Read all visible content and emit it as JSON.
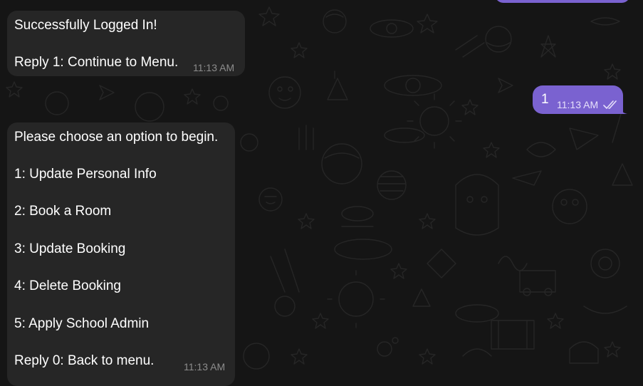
{
  "messages": [
    {
      "direction": "incoming",
      "lines": [
        "Successfully Logged In!",
        "",
        "Reply 1: Continue to Menu."
      ],
      "time": "11:13 AM"
    },
    {
      "direction": "outgoing",
      "text": "1",
      "time": "11:13 AM",
      "status_icon": "double-check-icon"
    },
    {
      "direction": "incoming",
      "lines": [
        "Please choose an option to begin.",
        "",
        "1: Update Personal Info",
        "",
        "2: Book a Room",
        "",
        "3: Update Booking",
        "",
        "4: Delete Booking",
        "",
        "5: Apply School Admin",
        "",
        "Reply 0: Back to menu."
      ],
      "time": "11:13 AM"
    }
  ],
  "colors": {
    "background": "#151515",
    "incoming_bubble": "#262626",
    "outgoing_bubble": "#7a62d0",
    "timestamp": "#8c8c8c"
  }
}
